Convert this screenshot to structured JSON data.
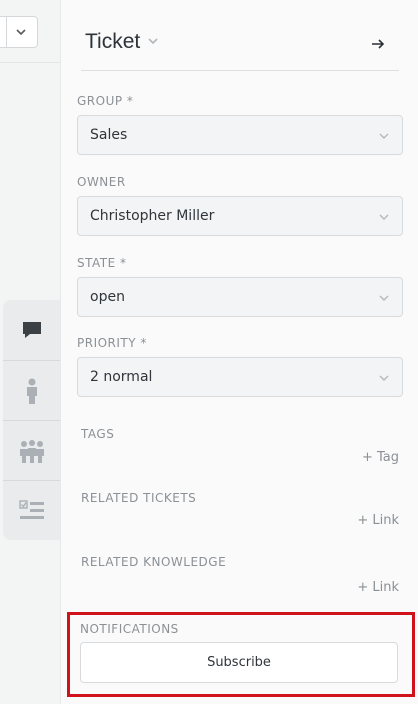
{
  "sidebar": {
    "title": "Ticket",
    "fields": {
      "group": {
        "label": "GROUP *",
        "value": "Sales"
      },
      "owner": {
        "label": "OWNER",
        "value": "Christopher Miller"
      },
      "state": {
        "label": "STATE *",
        "value": "open"
      },
      "priority": {
        "label": "PRIORITY *",
        "value": "2 normal"
      }
    },
    "tags": {
      "label": "TAGS",
      "action": "+ Tag"
    },
    "related_tickets": {
      "label": "RELATED TICKETS",
      "action": "+ Link"
    },
    "related_knowledge": {
      "label": "RELATED KNOWLEDGE",
      "action": "+ Link"
    },
    "notifications": {
      "label": "NOTIFICATIONS",
      "button": "Subscribe"
    }
  },
  "icon_tabs": [
    "ticket-icon",
    "customer-icon",
    "organization-icon",
    "checklist-icon"
  ],
  "colors": {
    "highlight": "#d0121b",
    "active_icon": "#3b4045",
    "inactive_icon": "#aab0b5"
  }
}
